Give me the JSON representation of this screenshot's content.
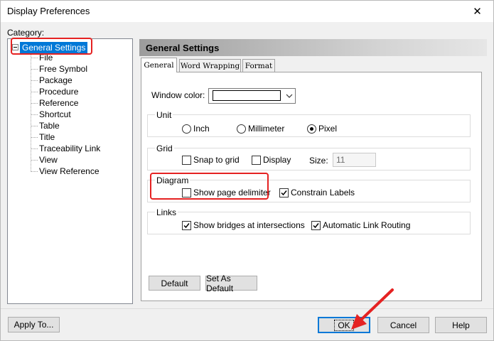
{
  "window": {
    "title": "Display Preferences",
    "close_glyph": "✕"
  },
  "category": {
    "label": "Category:",
    "root": "General Settings",
    "items": [
      "File",
      "Free Symbol",
      "Package",
      "Procedure",
      "Reference",
      "Shortcut",
      "Table",
      "Title",
      "Traceability Link",
      "View",
      "View Reference"
    ]
  },
  "panel": {
    "header": "General Settings",
    "tabs": [
      "General",
      "Word Wrapping",
      "Format"
    ],
    "window_color": {
      "label": "Window color:",
      "value": "#ffffff"
    },
    "unit": {
      "title": "Unit",
      "options": [
        "Inch",
        "Millimeter",
        "Pixel"
      ],
      "selected": "Pixel"
    },
    "grid": {
      "title": "Grid",
      "snap_label": "Snap to grid",
      "snap_checked": false,
      "display_label": "Display",
      "display_checked": false,
      "size_label": "Size:",
      "size_value": "11"
    },
    "diagram": {
      "title": "Diagram",
      "page_delimiter_label": "Show page delimiter",
      "page_delimiter_checked": false,
      "constrain_label": "Constrain Labels",
      "constrain_checked": true
    },
    "links": {
      "title": "Links",
      "bridges_label": "Show bridges at intersections",
      "bridges_checked": true,
      "routing_label": "Automatic Link Routing",
      "routing_checked": true
    },
    "default_button": "Default",
    "set_default_button": "Set As Default"
  },
  "footer": {
    "apply_button": "Apply To...",
    "ok_button": "OK",
    "cancel_button": "Cancel",
    "help_button": "Help"
  },
  "colors": {
    "selection": "#0078d7",
    "highlight_annotation": "#e52222"
  }
}
